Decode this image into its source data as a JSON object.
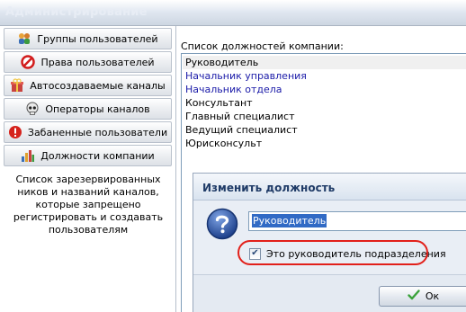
{
  "window": {
    "title": "Администрирование"
  },
  "sidebar": {
    "items": [
      {
        "label": "Группы пользователей",
        "icon": "users-group-icon"
      },
      {
        "label": "Права пользователей",
        "icon": "forbidden-icon"
      },
      {
        "label": "Автосоздаваемые каналы",
        "icon": "gift-box-icon"
      },
      {
        "label": "Операторы каналов",
        "icon": "skull-icon"
      },
      {
        "label": "Забаненные пользователи",
        "icon": "warning-icon"
      },
      {
        "label": "Должности компании",
        "icon": "bar-chart-icon"
      }
    ],
    "description": "Список зарезервированных ников и названий каналов, которые запрещено регистрировать и создавать пользователям"
  },
  "main": {
    "list_label": "Список должностей компании:",
    "positions": [
      {
        "label": "Руководитель",
        "color": "#000000",
        "selected": true
      },
      {
        "label": "Начальник управления",
        "color": "#1a1aa8"
      },
      {
        "label": "Начальник отдела",
        "color": "#1a1aa8"
      },
      {
        "label": "Консультант",
        "color": "#000000"
      },
      {
        "label": "Главный специалист",
        "color": "#000000"
      },
      {
        "label": "Ведущий специалист",
        "color": "#000000"
      },
      {
        "label": "Юрисконсульт",
        "color": "#000000"
      }
    ]
  },
  "dialog": {
    "title": "Изменить должность",
    "name_value": "Руководитель",
    "checkbox_label": "Это руководитель подразделения",
    "checkbox_checked": true,
    "ok_label": "Ок"
  },
  "colors": {
    "accent": "#316ac5",
    "highlight_ring": "#e2201a",
    "link_blue": "#1a1aa8"
  }
}
